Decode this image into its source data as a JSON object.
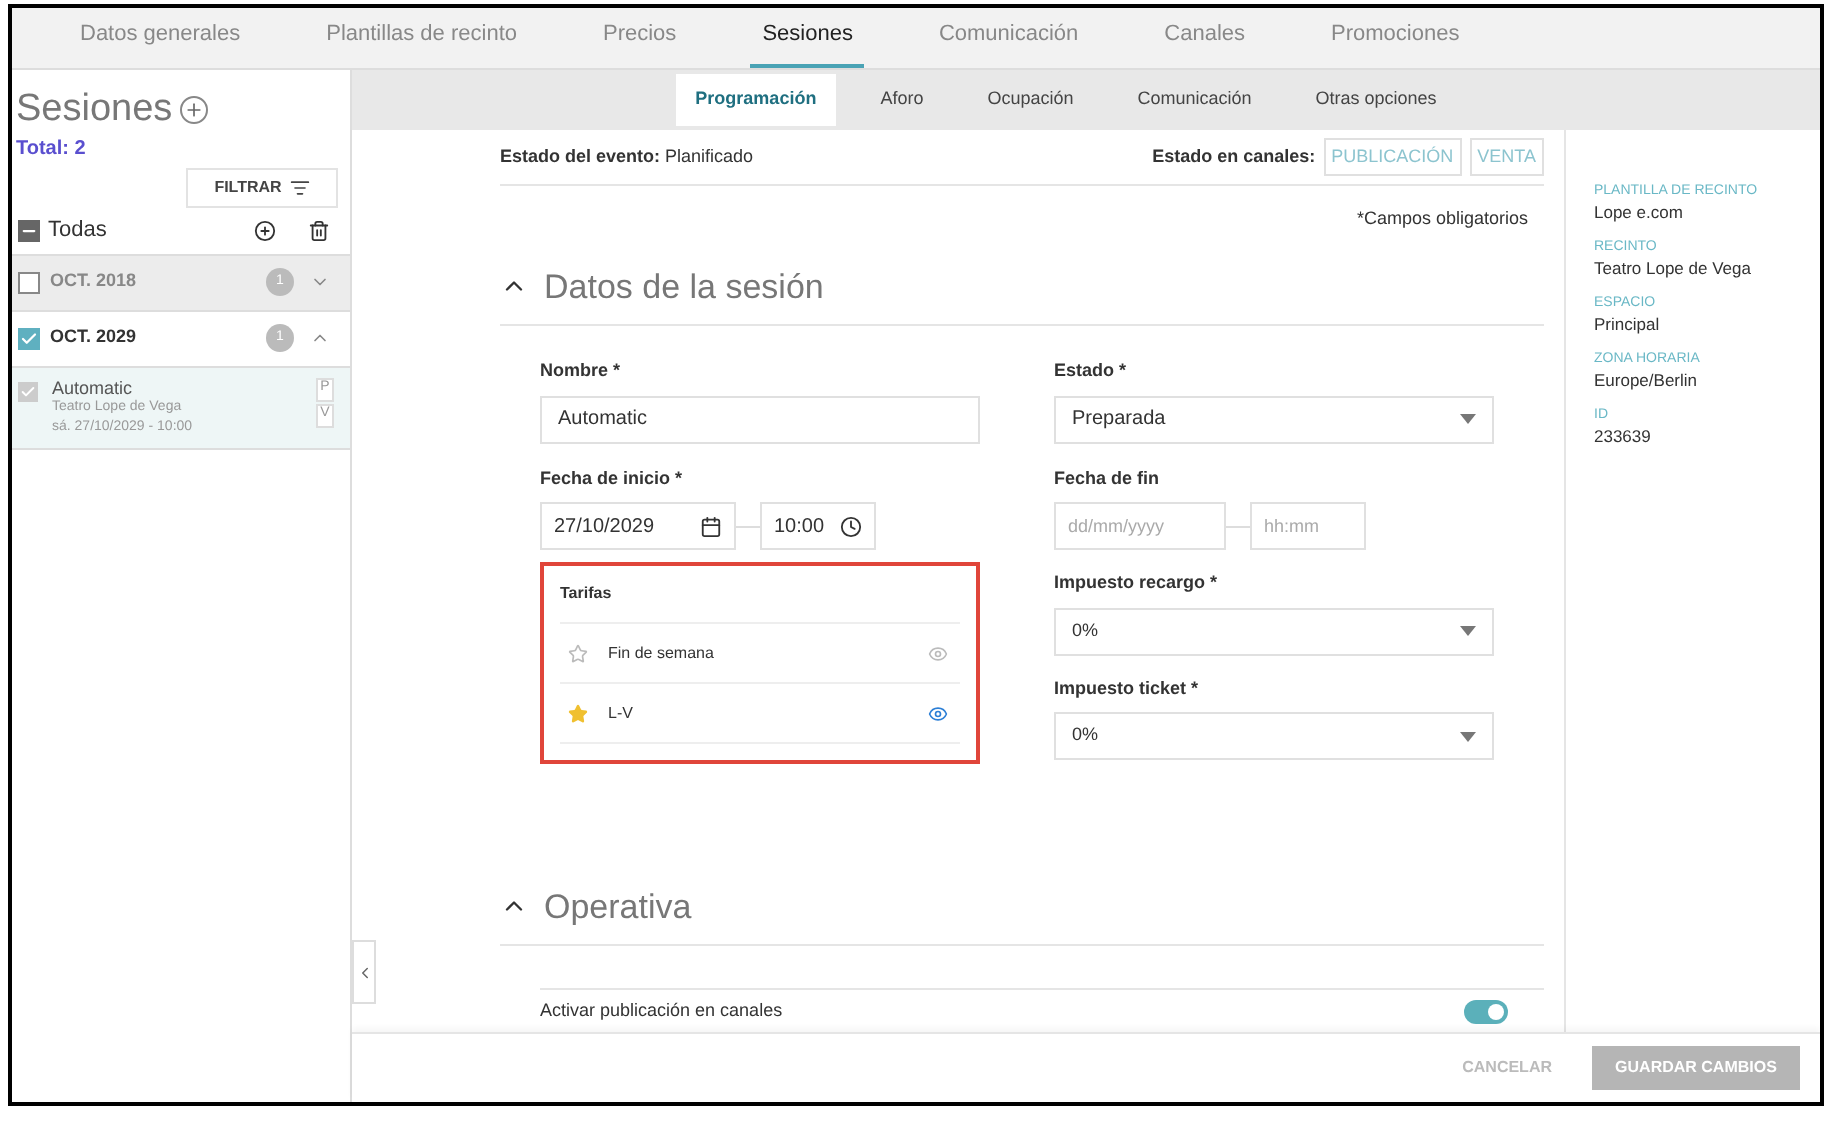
{
  "top_tabs": [
    {
      "label": "Datos generales",
      "selected": false
    },
    {
      "label": "Plantillas de recinto",
      "selected": false
    },
    {
      "label": "Precios",
      "selected": false
    },
    {
      "label": "Sesiones",
      "selected": true
    },
    {
      "label": "Comunicación",
      "selected": false
    },
    {
      "label": "Canales",
      "selected": false
    },
    {
      "label": "Promociones",
      "selected": false
    }
  ],
  "sidebar": {
    "title": "Sesiones",
    "total": "Total: 2",
    "filter_button": "FILTRAR",
    "select_all": {
      "label": "Todas",
      "indeterminate": true
    },
    "groups": [
      {
        "label": "OCT. 2018",
        "count": "1",
        "checked": false,
        "expanded": false
      },
      {
        "label": "OCT. 2029",
        "count": "1",
        "checked": true,
        "expanded": true,
        "sessions": [
          {
            "name": "Automatic",
            "venue": "Teatro Lope de Vega",
            "date": "sá. 27/10/2029 - 10:00",
            "checked": true,
            "badges": [
              "P",
              "V"
            ]
          }
        ]
      }
    ]
  },
  "sub_tabs": [
    {
      "label": "Programación",
      "selected": true
    },
    {
      "label": "Aforo",
      "selected": false
    },
    {
      "label": "Ocupación",
      "selected": false
    },
    {
      "label": "Comunicación",
      "selected": false
    },
    {
      "label": "Otras opciones",
      "selected": false
    }
  ],
  "event_status": {
    "label": "Estado del evento:",
    "value": "Planificado"
  },
  "channel_status": {
    "label": "Estado en canales:",
    "tags": [
      "PUBLICACIÓN",
      "VENTA"
    ]
  },
  "required_note": "*Campos obligatorios",
  "session_section": {
    "title": "Datos de la sesión",
    "expanded": true,
    "name": {
      "label": "Nombre *",
      "value": "Automatic"
    },
    "state": {
      "label": "Estado *",
      "value": "Preparada"
    },
    "start": {
      "label": "Fecha de inicio *",
      "date": "27/10/2029",
      "time": "10:00"
    },
    "end": {
      "label": "Fecha de fin",
      "date_placeholder": "dd/mm/yyyy",
      "time_placeholder": "hh:mm"
    },
    "rates": {
      "label": "Tarifas",
      "highlighted": true,
      "items": [
        {
          "name": "Fin de semana",
          "favorite": false,
          "visible": false
        },
        {
          "name": "L-V",
          "favorite": true,
          "visible": true
        }
      ]
    },
    "surcharge_tax": {
      "label": "Impuesto recargo *",
      "value": "0%"
    },
    "ticket_tax": {
      "label": "Impuesto ticket *",
      "value": "0%"
    }
  },
  "operations_section": {
    "title": "Operativa",
    "expanded": true,
    "toggle": {
      "label": "Activar publicación en canales",
      "on": true
    }
  },
  "info": [
    {
      "label": "PLANTILLA DE RECINTO",
      "value": "Lope e.com"
    },
    {
      "label": "RECINTO",
      "value": "Teatro Lope de Vega"
    },
    {
      "label": "ESPACIO",
      "value": "Principal"
    },
    {
      "label": "ZONA HORARIA",
      "value": "Europe/Berlin"
    },
    {
      "label": "ID",
      "value": "233639"
    }
  ],
  "footer": {
    "cancel": "CANCELAR",
    "save": "GUARDAR CAMBIOS",
    "save_disabled": true
  }
}
